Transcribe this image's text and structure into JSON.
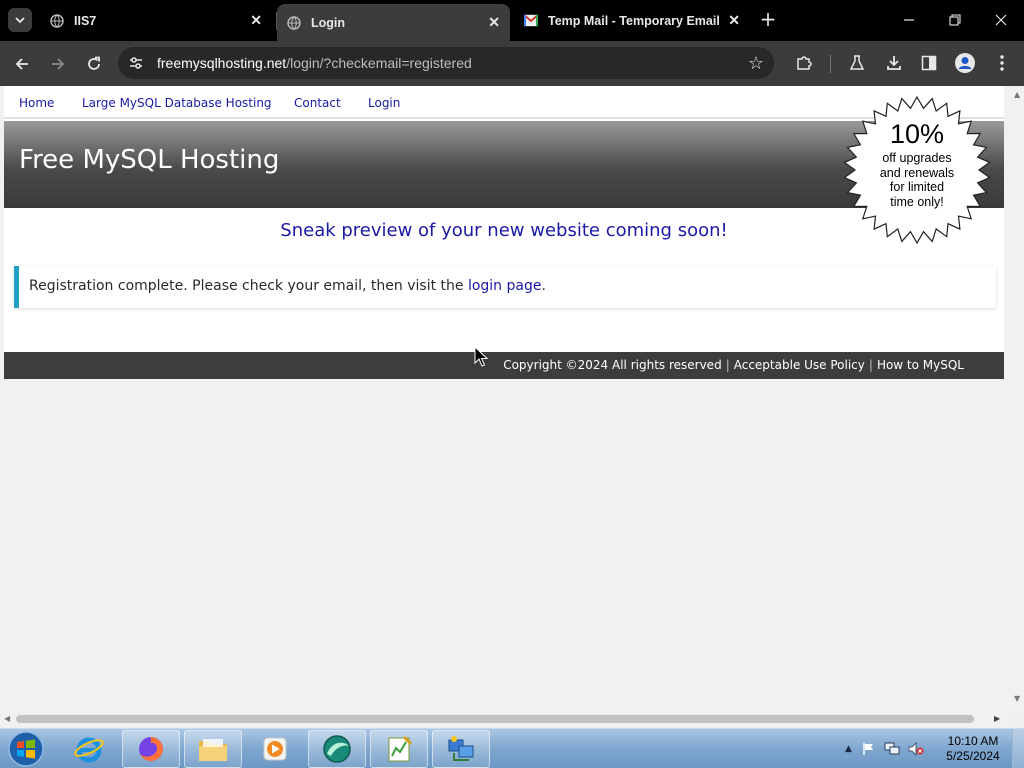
{
  "browser": {
    "tabs": [
      {
        "title": "IIS7",
        "favicon": "globe-icon",
        "active": false
      },
      {
        "title": "Login",
        "favicon": "globe-icon",
        "active": true
      },
      {
        "title": "Temp Mail - Temporary Email",
        "favicon": "gmail-icon",
        "active": false
      }
    ],
    "url_host": "freemysqlhosting.net",
    "url_path": "/login/?checkemail=registered"
  },
  "site": {
    "nav": [
      "Home",
      "Large MySQL Database Hosting",
      "Contact",
      "Login"
    ],
    "brand": "Free MySQL Hosting",
    "promo": {
      "percent": "10%",
      "line1": "off upgrades",
      "line2": "and renewals",
      "line3": "for limited",
      "line4": "time only!"
    },
    "sneak_preview": "Sneak preview of your new website coming soon!",
    "notice": {
      "text": "Registration complete. Please check your email, then visit the ",
      "link": "login page",
      "suffix": "."
    },
    "footer": {
      "copyright": "Copyright ©2024 All rights reserved",
      "aup": "Acceptable Use Policy",
      "howto": "How to MySQL"
    }
  },
  "taskbar": {
    "time": "10:10 AM",
    "date": "5/25/2024"
  },
  "colors": {
    "link": "#1a1aa6",
    "notice_accent": "#1fa2c4",
    "footer_bg": "#3d3d3d"
  }
}
